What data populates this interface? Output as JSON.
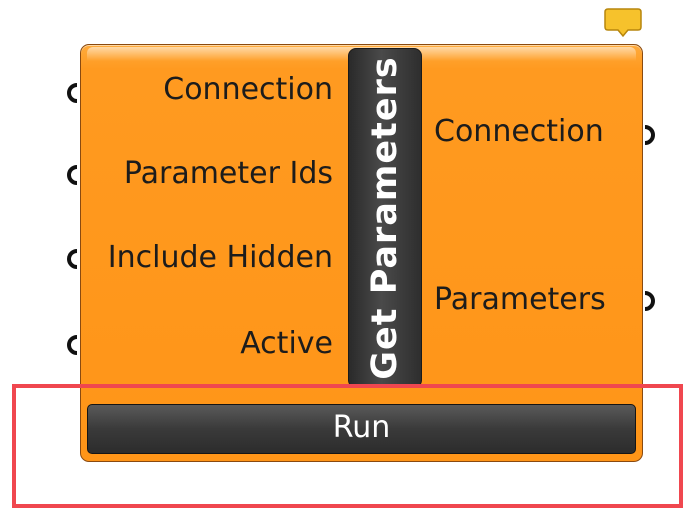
{
  "component": {
    "nickname": "Get Parameters",
    "body_color": "#ff9a20",
    "inputs": [
      {
        "label": "Connection"
      },
      {
        "label": "Parameter Ids"
      },
      {
        "label": "Include Hidden"
      },
      {
        "label": "Active"
      }
    ],
    "outputs": [
      {
        "label": "Connection"
      },
      {
        "label": "Parameters"
      }
    ],
    "run_label": "Run",
    "balloon_icon": "comment-balloon-icon",
    "grip_icon": "port-grip-icon"
  },
  "highlight": {
    "color": "#f0474f"
  }
}
